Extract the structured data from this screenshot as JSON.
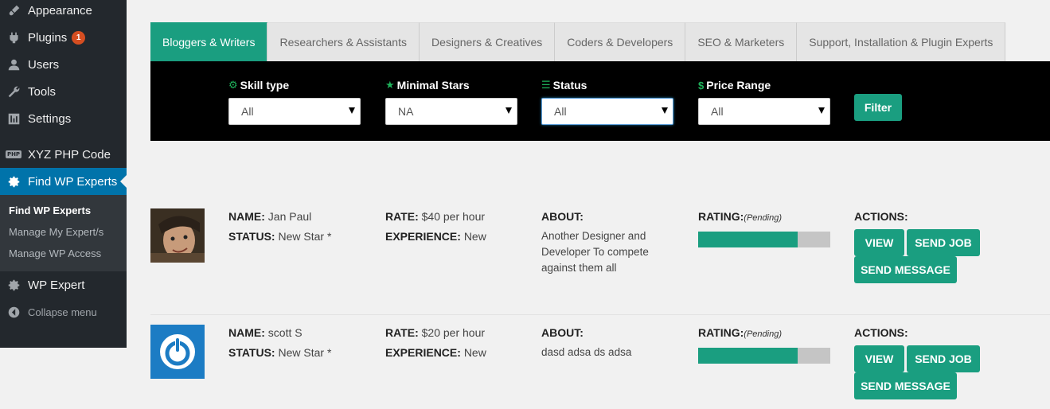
{
  "sidebar": {
    "items": [
      {
        "label": "Appearance",
        "icon": "paintbrush-icon"
      },
      {
        "label": "Plugins",
        "icon": "plugin-icon",
        "badge": "1"
      },
      {
        "label": "Users",
        "icon": "user-icon"
      },
      {
        "label": "Tools",
        "icon": "wrench-icon"
      },
      {
        "label": "Settings",
        "icon": "settings-icon"
      },
      {
        "label": "XYZ PHP Code",
        "icon": "php-icon"
      },
      {
        "label": "Find WP Experts",
        "icon": "gear-icon"
      },
      {
        "label": "WP Expert",
        "icon": "gear-icon"
      },
      {
        "label": "Collapse menu",
        "icon": "collapse-icon"
      }
    ],
    "php_icon_text": "PHP",
    "submenu": [
      "Find WP Experts",
      "Manage My Expert/s",
      "Manage WP Access"
    ]
  },
  "tabs": [
    "Bloggers & Writers",
    "Researchers & Assistants",
    "Designers & Creatives",
    "Coders & Developers",
    "SEO & Marketers",
    "Support, Installation & Plugin Experts"
  ],
  "filters": [
    {
      "label": "Skill type",
      "icon": "gear-icon",
      "value": "All"
    },
    {
      "label": "Minimal Stars",
      "icon": "star-icon",
      "value": "NA"
    },
    {
      "label": "Status",
      "icon": "sliders-icon",
      "value": "All"
    },
    {
      "label": "Price Range",
      "icon": "dollar-icon",
      "value": "All"
    }
  ],
  "filter_button": "Filter",
  "labels": {
    "name": "NAME:",
    "status": "STATUS:",
    "rate": "RATE:",
    "experience": "EXPERIENCE:",
    "about": "ABOUT:",
    "rating": "RATING:",
    "pending": "(Pending)",
    "actions": "ACTIONS:"
  },
  "buttons": {
    "view": "VIEW",
    "send_job": "SEND JOB",
    "send_message": "SEND MESSAGE"
  },
  "experts": [
    {
      "name": "Jan Paul",
      "status": "New Star *",
      "rate": "$40 per hour",
      "experience": "New",
      "about": "Another Designer and Developer To compete against them all",
      "rating_fraction": 0.75
    },
    {
      "name": "scott S",
      "status": "New Star *",
      "rate": "$20 per hour",
      "experience": "New",
      "about": "dasd adsa ds adsa",
      "rating_fraction": 0.75
    }
  ],
  "colors": {
    "accent": "#1a9e80",
    "sidebar": "#23282d",
    "sidebar_active": "#0073aa",
    "badge": "#d54e21"
  }
}
